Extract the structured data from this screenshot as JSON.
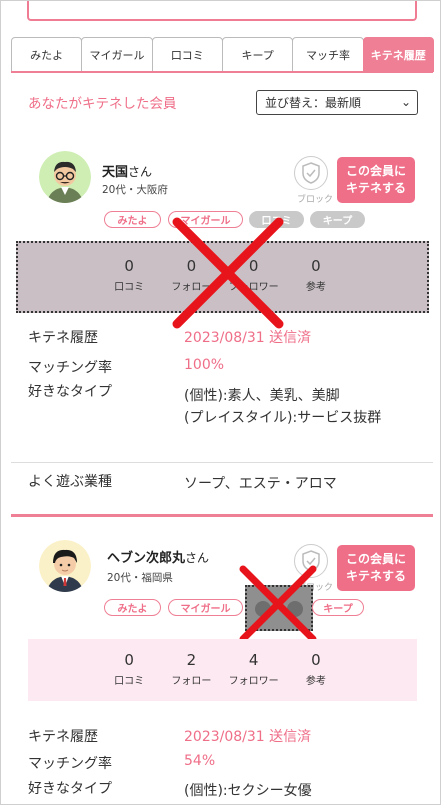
{
  "tabs": [
    "みたよ",
    "マイガール",
    "口コミ",
    "キープ",
    "マッチ率",
    "キテネ履歴"
  ],
  "section_title": "あなたがキテネした会員",
  "sort": {
    "selected": "並び替え：最新順"
  },
  "members": [
    {
      "name": "天国",
      "honorific": "さん",
      "sub": "20代・大阪府",
      "block_label": "ブロック",
      "kitene_btn": [
        "この会員に",
        "キテネする"
      ],
      "pills": [
        "みたよ",
        "マイガール",
        "口コミ",
        "キープ"
      ],
      "stats": [
        {
          "num": "0",
          "label": "口コミ"
        },
        {
          "num": "0",
          "label": "フォロー"
        },
        {
          "num": "0",
          "label": "フォロワー"
        },
        {
          "num": "0",
          "label": "参考"
        }
      ],
      "rows": [
        {
          "label": "キテネ履歴",
          "value": "2023/08/31 送信済"
        },
        {
          "label": "マッチング率",
          "value": "100%"
        },
        {
          "label": "好きなタイプ",
          "value": "(個性):素人、美乳、美脚"
        },
        {
          "label": "",
          "value": "(プレイスタイル):サービス抜群"
        },
        {
          "label": "よく遊ぶ業種",
          "value": "ソープ、エステ・アロマ"
        }
      ]
    },
    {
      "name": "ヘブン次郎丸",
      "honorific": "さん",
      "sub": "20代・福岡県",
      "block_label": "ブロック",
      "kitene_btn": [
        "この会員に",
        "キテネする"
      ],
      "pills": [
        "みたよ",
        "マイガール",
        "キープ"
      ],
      "stats": [
        {
          "num": "0",
          "label": "口コミ"
        },
        {
          "num": "2",
          "label": "フォロー"
        },
        {
          "num": "4",
          "label": "フォロワー"
        },
        {
          "num": "0",
          "label": "参考"
        }
      ],
      "rows": [
        {
          "label": "キテネ履歴",
          "value": "2023/08/31 送信済"
        },
        {
          "label": "マッチング率",
          "value": "54%"
        },
        {
          "label": "好きなタイプ",
          "value": "(個性):セクシー女優"
        }
      ]
    }
  ],
  "colors": {
    "accent": "#ef6e88",
    "redx": "#e8141b",
    "grey_pill": "#c9c9c9"
  }
}
